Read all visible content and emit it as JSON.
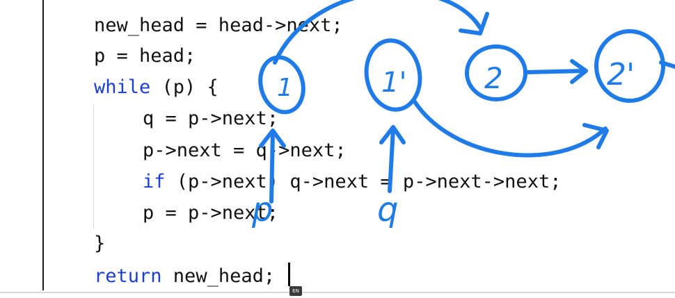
{
  "editor": {
    "lines": [
      {
        "code": "new_head = head->next;"
      },
      {
        "code": "p = head;"
      },
      {
        "kw": "while",
        "rest": " (p) {"
      },
      {
        "code": "q = p->next;"
      },
      {
        "code": "p->next = q->next;"
      },
      {
        "kw": "if",
        "rest": " (p->next) q->next = p->next->next;"
      },
      {
        "code": "p = p->next;"
      },
      {
        "code": "}"
      },
      {
        "kw": "return",
        "rest": " new_head;"
      }
    ],
    "input_method_badge": "EN"
  },
  "annotations": {
    "color": "#1f7be8",
    "nodes": [
      "1",
      "1'",
      "2",
      "2'"
    ],
    "pointer_labels": [
      "p",
      "q"
    ]
  }
}
